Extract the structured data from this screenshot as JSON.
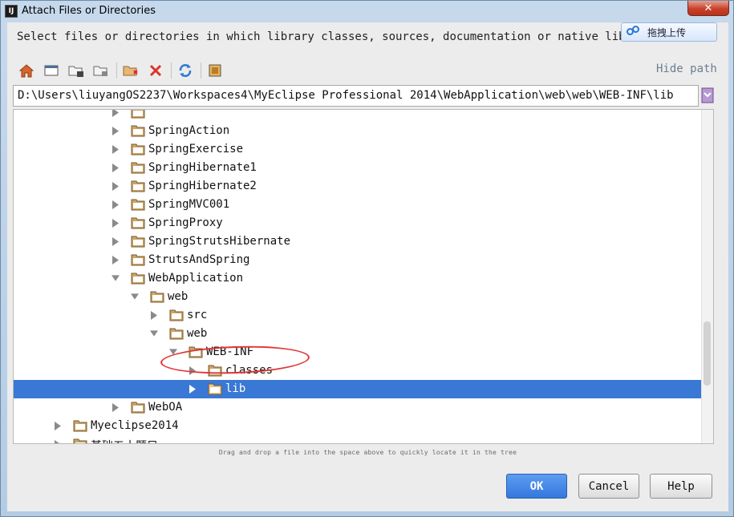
{
  "window": {
    "app_icon_text": "IJ",
    "title": "Attach Files or Directories",
    "close_symbol": "✕"
  },
  "description": "Select files or directories in which library classes, sources, documentation or native libraries are located",
  "baidu_upload": {
    "label": "拖拽上传",
    "icon": "cloud-upload-icon"
  },
  "toolbar": {
    "icons": [
      "home-icon",
      "desktop-icon",
      "project-folder-icon",
      "module-folder-icon",
      "new-folder-icon",
      "delete-icon",
      "refresh-icon",
      "show-hidden-icon"
    ],
    "hide_path_label": "Hide path"
  },
  "path": {
    "value": "D:\\Users\\liuyangOS2237\\Workspaces4\\MyEclipse Professional 2014\\WebApplication\\web\\web\\WEB-INF\\lib"
  },
  "tree": {
    "rows": [
      {
        "label": "",
        "expanded": false,
        "partial": true
      },
      {
        "label": "SpringAction",
        "expanded": false
      },
      {
        "label": "SpringExercise",
        "expanded": false
      },
      {
        "label": "SpringHibernate1",
        "expanded": false
      },
      {
        "label": "SpringHibernate2",
        "expanded": false
      },
      {
        "label": "SpringMVC001",
        "expanded": false
      },
      {
        "label": "SpringProxy",
        "expanded": false
      },
      {
        "label": "SpringStrutsHibernate",
        "expanded": false
      },
      {
        "label": "StrutsAndSpring",
        "expanded": false
      },
      {
        "label": "WebApplication",
        "expanded": true
      },
      {
        "label": "web",
        "expanded": true
      },
      {
        "label": "src",
        "expanded": false
      },
      {
        "label": "web",
        "expanded": true
      },
      {
        "label": "WEB-INF",
        "expanded": true
      },
      {
        "label": "classes",
        "expanded": false
      },
      {
        "label": "lib",
        "expanded": false,
        "selected": true
      },
      {
        "label": "WebOA",
        "expanded": false
      },
      {
        "label": "Myeclipse2014",
        "expanded": false
      },
      {
        "label": "基础五十题目",
        "expanded": false
      }
    ]
  },
  "hint": "Drag and drop a file into the space above to quickly locate it in the tree",
  "buttons": {
    "ok": "OK",
    "cancel": "Cancel",
    "help": "Help"
  },
  "colors": {
    "selection": "#3a78d6",
    "annotation": "#e03535",
    "folder": "#c8a46a"
  }
}
